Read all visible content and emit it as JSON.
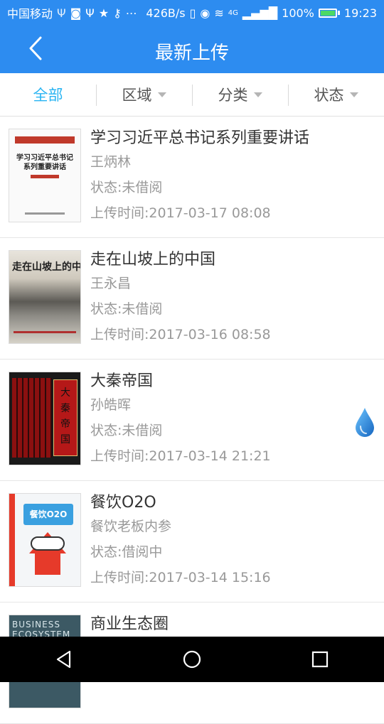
{
  "statusbar": {
    "carrier": "中国移动",
    "speed": "426B/s",
    "network": "4G",
    "battery": "100%",
    "time": "19:23"
  },
  "header": {
    "title": "最新上传"
  },
  "filters": [
    {
      "label": "全部",
      "active": true
    },
    {
      "label": "区域"
    },
    {
      "label": "分类"
    },
    {
      "label": "状态"
    }
  ],
  "books": [
    {
      "title": "学习习近平总书记系列重要讲话",
      "author": "王炳林",
      "status": "状态:未借阅",
      "upload": "上传时间:2017-03-17 08:08",
      "cover_text": "学习习近平总书记\n系列重要讲话"
    },
    {
      "title": "走在山坡上的中国",
      "author": "王永昌",
      "status": "状态:未借阅",
      "upload": "上传时间:2017-03-16 08:58",
      "cover_text": "走在山坡上的中国"
    },
    {
      "title": "大秦帝国",
      "author": "孙皓晖",
      "status": "状态:未借阅",
      "upload": "上传时间:2017-03-14 21:21",
      "cover_text": "大秦帝国"
    },
    {
      "title": "餐饮O2O",
      "author": "餐饮老板内参",
      "status": "状态:借阅中",
      "upload": "上传时间:2017-03-14 15:16",
      "cover_text": "餐饮O2O"
    },
    {
      "title": "商业生态圈",
      "author": "",
      "status": "",
      "upload": "",
      "cover_text": "BUSINESS ECOSYSTEM"
    }
  ],
  "colors": {
    "primary": "#2d8cf0",
    "active_tab": "#28b4f2",
    "title_text": "#333333",
    "meta_text": "#999999"
  }
}
